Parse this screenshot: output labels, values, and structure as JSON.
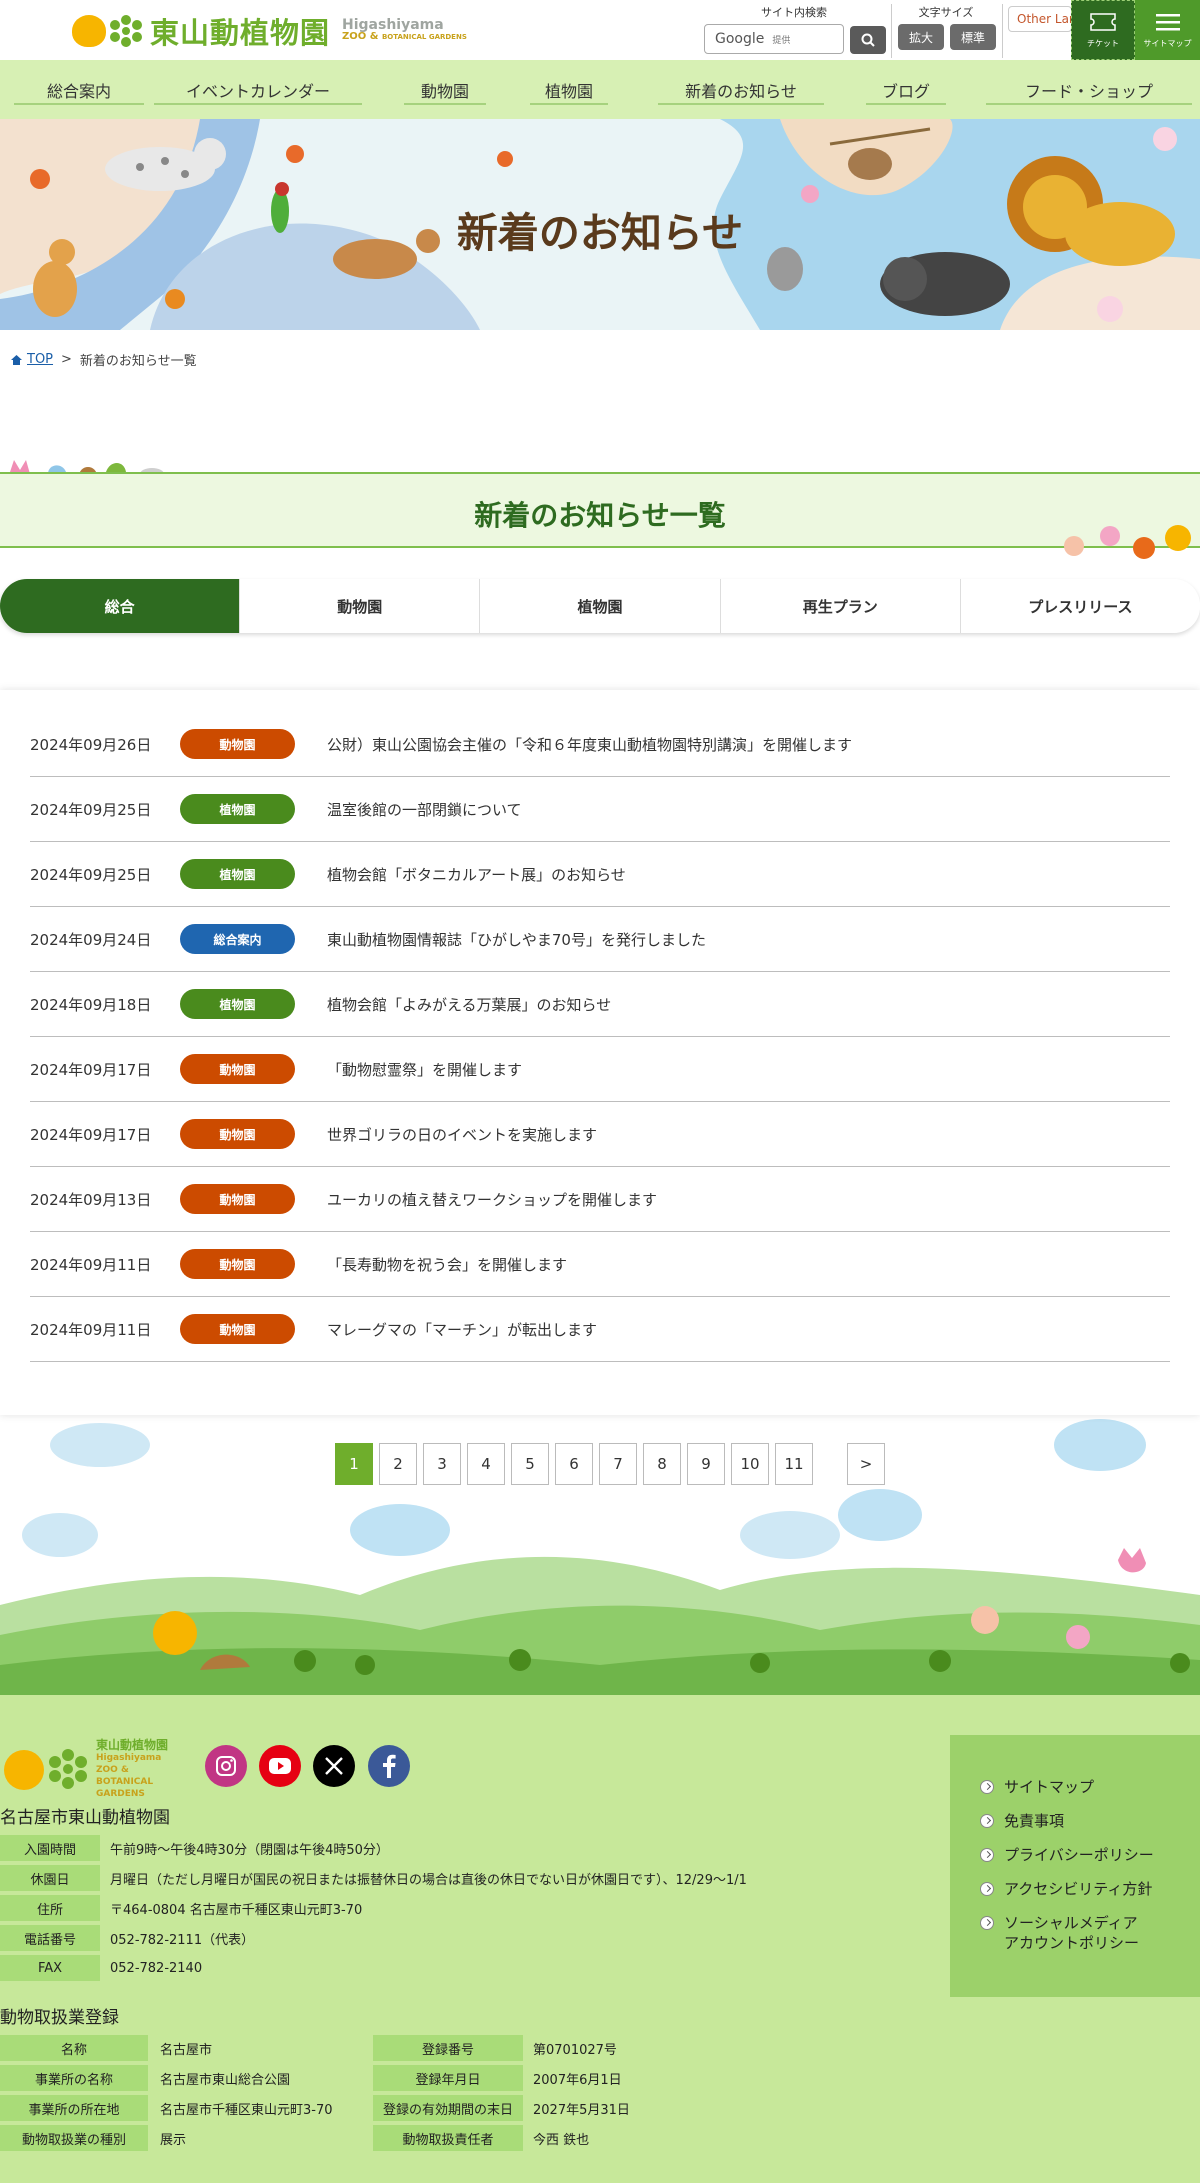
{
  "header": {
    "logo_jp": "東山動植物園",
    "logo_en_1": "Higashiyama",
    "logo_en_2": "ZOO &",
    "logo_en_3": "BOTANICAL GARDENS",
    "search_title": "サイト内検索",
    "search_brand": "Google",
    "search_brand_sub": "提供",
    "fontsize_title": "文字サイズ",
    "fontsize_large": "拡大",
    "fontsize_normal": "標準",
    "lang_label": "Other Languages",
    "ticket_label": "チケット",
    "sitemap_label": "サイトマップ"
  },
  "nav": [
    {
      "label": "総合案内"
    },
    {
      "label": "イベントカレンダー"
    },
    {
      "label": "動物園"
    },
    {
      "label": "植物園"
    },
    {
      "label": "新着のお知らせ"
    },
    {
      "label": "ブログ"
    },
    {
      "label": "フード・ショップ"
    }
  ],
  "hero": {
    "title": "新着のお知らせ"
  },
  "breadcrumb": {
    "top": "TOP",
    "sep": ">",
    "current": "新着のお知らせ一覧"
  },
  "section": {
    "title": "新着のお知らせ一覧"
  },
  "tabs": [
    {
      "label": "総合"
    },
    {
      "label": "動物園"
    },
    {
      "label": "植物園"
    },
    {
      "label": "再生プラン"
    },
    {
      "label": "プレスリリース"
    }
  ],
  "news": [
    {
      "date": "2024年09月26日",
      "category": "動物園",
      "title": "公財）東山公園協会主催の「令和６年度東山動植物園特別講演」を開催します"
    },
    {
      "date": "2024年09月25日",
      "category": "植物園",
      "title": "温室後館の一部閉鎖について"
    },
    {
      "date": "2024年09月25日",
      "category": "植物園",
      "title": "植物会館「ボタニカルアート展」のお知らせ"
    },
    {
      "date": "2024年09月24日",
      "category": "総合案内",
      "title": "東山動植物園情報誌「ひがしやま70号」を発行しました"
    },
    {
      "date": "2024年09月18日",
      "category": "植物園",
      "title": "植物会館「よみがえる万葉展」のお知らせ"
    },
    {
      "date": "2024年09月17日",
      "category": "動物園",
      "title": "「動物慰霊祭」を開催します"
    },
    {
      "date": "2024年09月17日",
      "category": "動物園",
      "title": "世界ゴリラの日のイベントを実施します"
    },
    {
      "date": "2024年09月13日",
      "category": "動物園",
      "title": "ユーカリの植え替えワークショップを開催します"
    },
    {
      "date": "2024年09月11日",
      "category": "動物園",
      "title": "「長寿動物を祝う会」を開催します"
    },
    {
      "date": "2024年09月11日",
      "category": "動物園",
      "title": "マレーグマの「マーチン」が転出します"
    }
  ],
  "pager": {
    "pages": [
      "1",
      "2",
      "3",
      "4",
      "5",
      "6",
      "7",
      "8",
      "9",
      "10",
      "11"
    ],
    "current": "1",
    "next": ">"
  },
  "footer": {
    "logo_jp": "東山動植物園",
    "logo_en": "Higashiyama ZOO & BOTANICAL GARDENS",
    "org_name": "名古屋市東山動植物園",
    "info": [
      {
        "label": "入園時間",
        "value": "午前9時～午後4時30分（閉園は午後4時50分）"
      },
      {
        "label": "休園日",
        "value": "月曜日（ただし月曜日が国民の祝日または振替休日の場合は直後の休日でない日が休園日です）、12/29～1/1"
      },
      {
        "label": "住所",
        "value": "〒464-0804 名古屋市千種区東山元町3-70"
      },
      {
        "label": "電話番号",
        "value": "052-782-2111（代表）"
      },
      {
        "label": "FAX",
        "value": "052-782-2140"
      }
    ],
    "registration_title": "動物取扱業登録",
    "registration": [
      {
        "label1": "名称",
        "value1": "名古屋市",
        "label2": "登録番号",
        "value2": "第0701027号"
      },
      {
        "label1": "事業所の名称",
        "value1": "名古屋市東山総合公園",
        "label2": "登録年月日",
        "value2": "2007年6月1日"
      },
      {
        "label1": "事業所の所在地",
        "value1": "名古屋市千種区東山元町3-70",
        "label2": "登録の有効期間の末日",
        "value2": "2027年5月31日"
      },
      {
        "label1": "動物取扱業の種別",
        "value1": "展示",
        "label2": "動物取扱責任者",
        "value2": "今西 鉄也"
      }
    ],
    "links": [
      {
        "label": "サイトマップ"
      },
      {
        "label": "免責事項"
      },
      {
        "label": "プライバシーポリシー"
      },
      {
        "label": "アクセシビリティ方針"
      },
      {
        "label": "ソーシャルメディア",
        "label2": "アカウントポリシー"
      }
    ]
  },
  "colors": {
    "brand_green": "#6fae2c",
    "dark_green": "#2e6b20",
    "nav_bg": "#d7f0b4",
    "footer_bg": "#c7e89a",
    "badge_zoo": "#cc4b00",
    "badge_botanical": "#4a8b1d",
    "badge_general": "#1f66b0"
  }
}
